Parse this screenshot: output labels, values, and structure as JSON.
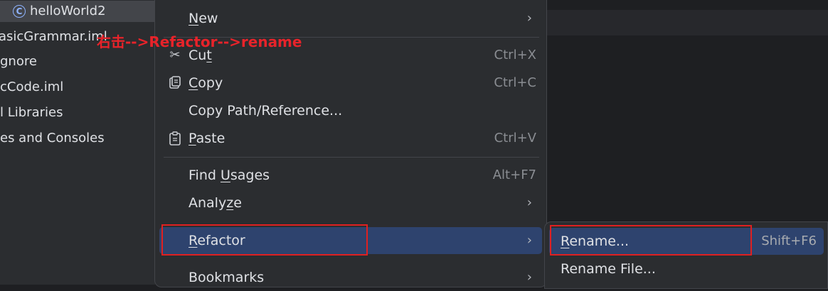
{
  "project_tree": {
    "top_item": "helloWorld2",
    "items": [
      "asicGrammar.iml",
      "gnore",
      "cCode.iml",
      "l Libraries",
      "es and Consoles"
    ]
  },
  "context_menu": {
    "new": "New",
    "cut": "Cut",
    "cut_shortcut": "Ctrl+X",
    "copy": "Copy",
    "copy_shortcut": "Ctrl+C",
    "copy_path": "Copy Path/Reference...",
    "paste": "Paste",
    "paste_shortcut": "Ctrl+V",
    "find_usages": "Find Usages",
    "find_usages_shortcut": "Alt+F7",
    "analyze": "Analyze",
    "refactor": "Refactor",
    "bookmarks": "Bookmarks"
  },
  "refactor_submenu": {
    "rename": "Rename...",
    "rename_shortcut": "Shift+F6",
    "rename_file": "Rename File..."
  },
  "annotation": "右击-->Refactor-->rename",
  "colors": {
    "highlight": "#2e436e",
    "annotation_red": "#e02020"
  }
}
